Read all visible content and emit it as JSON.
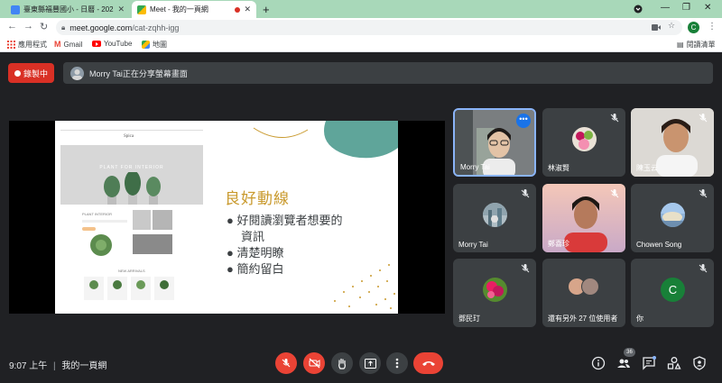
{
  "browser": {
    "tabs": [
      {
        "title": "臺東縣福豐國小 - 日曆 - 2021年…",
        "active": false
      },
      {
        "title": "Meet - 我的一頁網",
        "active": true,
        "recording": true
      }
    ],
    "new_tab_label": "+",
    "url_host": "meet.google.com",
    "url_path": "/cat-zqhh-igg",
    "profile_initial": "C",
    "bookmarks": [
      "應用程式",
      "Gmail",
      "YouTube",
      "地圖"
    ],
    "reading_list": "閱讀清單"
  },
  "meet": {
    "recording_label": "錄製中",
    "share_banner": "Morry Tai正在分享螢幕畫面",
    "slide": {
      "site_logo": "Spica",
      "hero_text": "PLANT FOR INTERIOR",
      "section_text": "PLANT INTERIOR",
      "products_text": "NEW ARRIVALS",
      "heading": "良好動線",
      "bullets": [
        "好閱讀瀏覽者想要的",
        "資訊",
        "清楚明瞭",
        "簡約留白"
      ]
    },
    "participants": [
      {
        "name": "Morry Tai",
        "type": "video"
      },
      {
        "name": "林淑賢",
        "type": "avatar"
      },
      {
        "name": "陳玉云",
        "type": "video"
      },
      {
        "name": "Morry Tai",
        "type": "avatar"
      },
      {
        "name": "鄭喜珍",
        "type": "video"
      },
      {
        "name": "Chowen Song",
        "type": "avatar"
      },
      {
        "name": "鄧民玎",
        "type": "avatar"
      },
      {
        "name": "還有另外 27 位使用者",
        "type": "group"
      },
      {
        "name": "你",
        "type": "initial",
        "initial": "C"
      }
    ],
    "more_options_glyph": "•••",
    "time": "9:07 上午",
    "separator": "|",
    "meeting_name": "我的一頁網",
    "people_count": "36"
  },
  "colors": {
    "accent_red": "#ea4335",
    "tab_strip": "#a8d8b9",
    "slide_gold": "#c99a2e",
    "slide_teal": "#5fa59a"
  }
}
